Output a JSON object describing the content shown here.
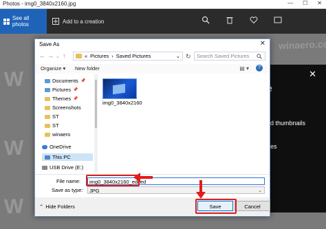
{
  "photos": {
    "title": "Photos - img0_3840x2160.jpg",
    "window_controls": [
      "—",
      "☐",
      "✕"
    ],
    "see_all_label": "See all photos",
    "add_creation_label": "Add to a creation",
    "watermark": "W",
    "watermark_text": "winaero.com",
    "info_pane": {
      "close": "✕",
      "big_text": "e",
      "line1": "nd thumbnails",
      "line2": "ges"
    }
  },
  "dialog": {
    "title": "Save As",
    "close": "✕",
    "address": {
      "path_prefix": "«",
      "crumb1": "Pictures",
      "sep": "›",
      "crumb2": "Saved Pictures",
      "chevron": "⌄"
    },
    "search_placeholder": "Search Saved Pictures",
    "toolbar": {
      "organize": "Organize ▾",
      "new_folder": "New folder",
      "help": "?"
    },
    "nav_items": [
      {
        "label": "Documents",
        "pinned": true
      },
      {
        "label": "Pictures",
        "pinned": true
      },
      {
        "label": "Themes",
        "pinned": true
      },
      {
        "label": "Screenshots",
        "pinned": false
      },
      {
        "label": "ST",
        "pinned": false
      },
      {
        "label": "ST",
        "pinned": false
      },
      {
        "label": "winaero",
        "pinned": false
      },
      {
        "label": "OneDrive",
        "pinned": false
      },
      {
        "label": "This PC",
        "pinned": false
      },
      {
        "label": "USB Drive (E:)",
        "pinned": false
      }
    ],
    "files": [
      {
        "name": "img0_3840x2160"
      }
    ],
    "file_name_label": "File name:",
    "file_name_value": "img0_3840x2160_edited",
    "save_as_type_label": "Save as type:",
    "save_as_type_value": "JPG",
    "hide_folders": "Hide Folders",
    "save_button": "Save",
    "cancel_button": "Cancel"
  }
}
